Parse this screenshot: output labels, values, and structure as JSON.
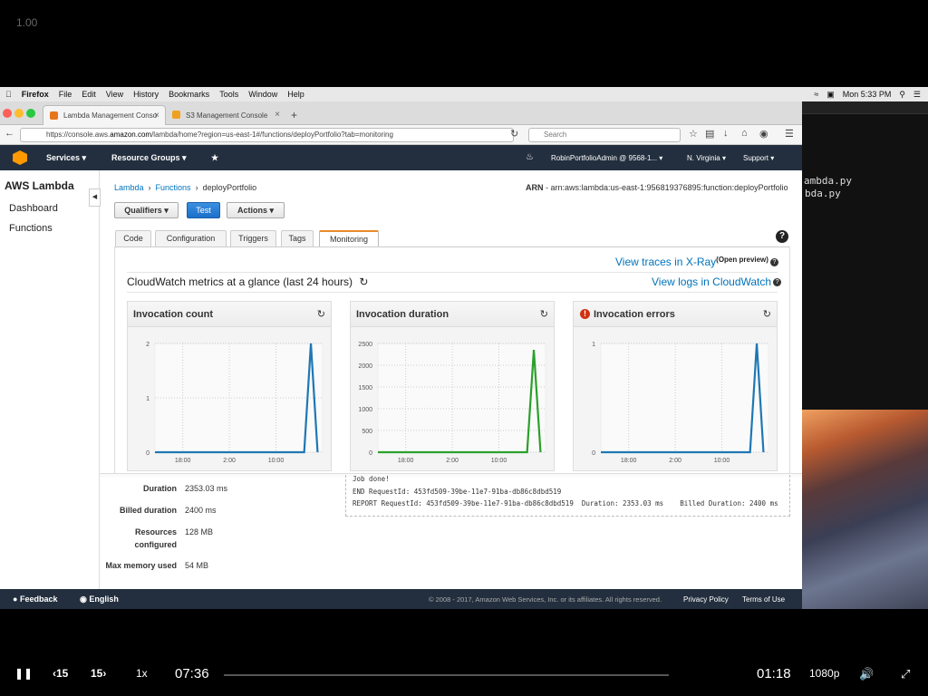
{
  "player": {
    "speed_top": "1.00",
    "rewind": "15",
    "forward": "15",
    "speed": "1x",
    "elapsed": "07:36",
    "remaining": "01:18",
    "quality": "1080p",
    "progress": 0
  },
  "menubar": {
    "app": "Firefox",
    "items": [
      "File",
      "Edit",
      "View",
      "History",
      "Bookmarks",
      "Tools",
      "Window",
      "Help"
    ],
    "clock": "Mon 5:33 PM"
  },
  "terminal": {
    "lines": [
      "ambda.py",
      "bda.py"
    ]
  },
  "browser": {
    "tabs": [
      {
        "label": "Lambda Management Conso"
      },
      {
        "label": "S3 Management Console"
      }
    ],
    "url_prefix": "https://console.aws.",
    "url_domain": "amazon.com",
    "url_rest": "/lambda/home?region=us-east-1#/functions/deployPortfolio?tab=monitoring",
    "search_placeholder": "Search"
  },
  "aws_nav": {
    "services": "Services",
    "resource_groups": "Resource Groups",
    "account": "RobinPortfolioAdmin @ 9568-1...",
    "region": "N. Virginia",
    "support": "Support"
  },
  "sidebar": {
    "title": "AWS Lambda",
    "items": [
      "Dashboard",
      "Functions"
    ]
  },
  "breadcrumb": {
    "lambda": "Lambda",
    "functions": "Functions",
    "current": "deployPortfolio"
  },
  "arn": {
    "label": "ARN",
    "value": "arn:aws:lambda:us-east-1:956819376895:function:deployPortfolio"
  },
  "actions": {
    "qualifiers": "Qualifiers",
    "test": "Test",
    "actions": "Actions"
  },
  "tabs": [
    "Code",
    "Configuration",
    "Triggers",
    "Tags",
    "Monitoring"
  ],
  "monitoring": {
    "xray": "View traces in X-Ray",
    "xray_sup": "(Open preview)",
    "glance": "CloudWatch metrics at a glance (last 24 hours)",
    "logs": "View logs in CloudWatch"
  },
  "chart_data": [
    {
      "type": "line",
      "title": "Invocation count",
      "x_ticks": [
        "18:00",
        "2:00",
        "10:00"
      ],
      "y_ticks": [
        "0",
        "1",
        "2"
      ],
      "ylim": [
        0,
        2
      ],
      "color": "#1f77b4",
      "x": [
        0,
        0.89,
        0.93,
        0.97
      ],
      "values": [
        0,
        0,
        2,
        0
      ]
    },
    {
      "type": "line",
      "title": "Invocation duration",
      "x_ticks": [
        "18:00",
        "2:00",
        "10:00"
      ],
      "y_ticks": [
        "0",
        "500",
        "1000",
        "1500",
        "2000",
        "2500"
      ],
      "ylim": [
        0,
        2500
      ],
      "color": "#2ca02c",
      "x": [
        0,
        0.89,
        0.93,
        0.97
      ],
      "values": [
        0,
        0,
        2353,
        0
      ]
    },
    {
      "type": "line",
      "title": "Invocation errors",
      "x_ticks": [
        "18:00",
        "2:00",
        "10:00"
      ],
      "y_ticks": [
        "0",
        "1"
      ],
      "ylim": [
        0,
        1
      ],
      "color": "#1f77b4",
      "x": [
        0,
        0.89,
        0.93,
        0.97
      ],
      "values": [
        0,
        0,
        1,
        0
      ]
    }
  ],
  "details": [
    {
      "label": "Duration",
      "value": "2353.03 ms"
    },
    {
      "label": "Billed duration",
      "value": "2400 ms"
    },
    {
      "label": "Resources configured",
      "value": "128 MB"
    },
    {
      "label": "Max memory used",
      "value": "54 MB"
    }
  ],
  "log": [
    "Job done!",
    "END RequestId: 453fd509-39be-11e7-91ba-db86c8dbd519",
    "REPORT RequestId: 453fd509-39be-11e7-91ba-db86c8dbd519  Duration: 2353.03 ms    Billed Duration: 2400 ms"
  ],
  "footer": {
    "feedback": "Feedback",
    "language": "English",
    "copyright": "© 2008 - 2017, Amazon Web Services, Inc. or its affiliates. All rights reserved.",
    "privacy": "Privacy Policy",
    "terms": "Terms of Use"
  }
}
